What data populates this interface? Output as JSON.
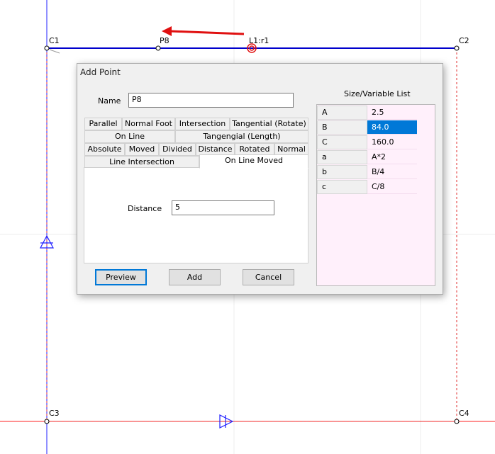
{
  "canvas": {
    "points": [
      {
        "id": "c1",
        "label": "C1"
      },
      {
        "id": "p8",
        "label": "P8"
      },
      {
        "id": "l1",
        "label": "L1:r1"
      },
      {
        "id": "c2",
        "label": "C2"
      },
      {
        "id": "c3",
        "label": "C3"
      },
      {
        "id": "c4",
        "label": "C4"
      }
    ],
    "colors": {
      "line": "#0000cc",
      "dashed": "#e03030",
      "arrow": "#e01010",
      "axis_x": "#ff2020",
      "axis_y": "#2020ff",
      "grid": "#ececec"
    }
  },
  "dialog": {
    "title": "Add Point",
    "name_label": "Name",
    "name_value": "P8",
    "tabs_row1": [
      "Parallel",
      "Normal Foot",
      "Intersection",
      "Tangential (Rotate)"
    ],
    "tabs_row2": [
      "On Line",
      "Tangengial (Length)"
    ],
    "tabs_row3": [
      "Absolute",
      "Moved",
      "Divided",
      "Distance",
      "Rotated",
      "Normal"
    ],
    "tabs_row4": [
      "Line Intersection",
      "On Line Moved"
    ],
    "active_tab": "On Line Moved",
    "distance_label": "Distance",
    "distance_value": "5",
    "buttons": {
      "preview": "Preview",
      "add": "Add",
      "cancel": "Cancel"
    },
    "variable_list": {
      "title": "Size/Variable List",
      "rows": [
        {
          "key": "A",
          "value": "2.5"
        },
        {
          "key": "B",
          "value": "84.0",
          "selected": true
        },
        {
          "key": "C",
          "value": "160.0"
        },
        {
          "key": "a",
          "value": "A*2"
        },
        {
          "key": "b",
          "value": "B/4"
        },
        {
          "key": "c",
          "value": "C/8"
        }
      ]
    }
  }
}
